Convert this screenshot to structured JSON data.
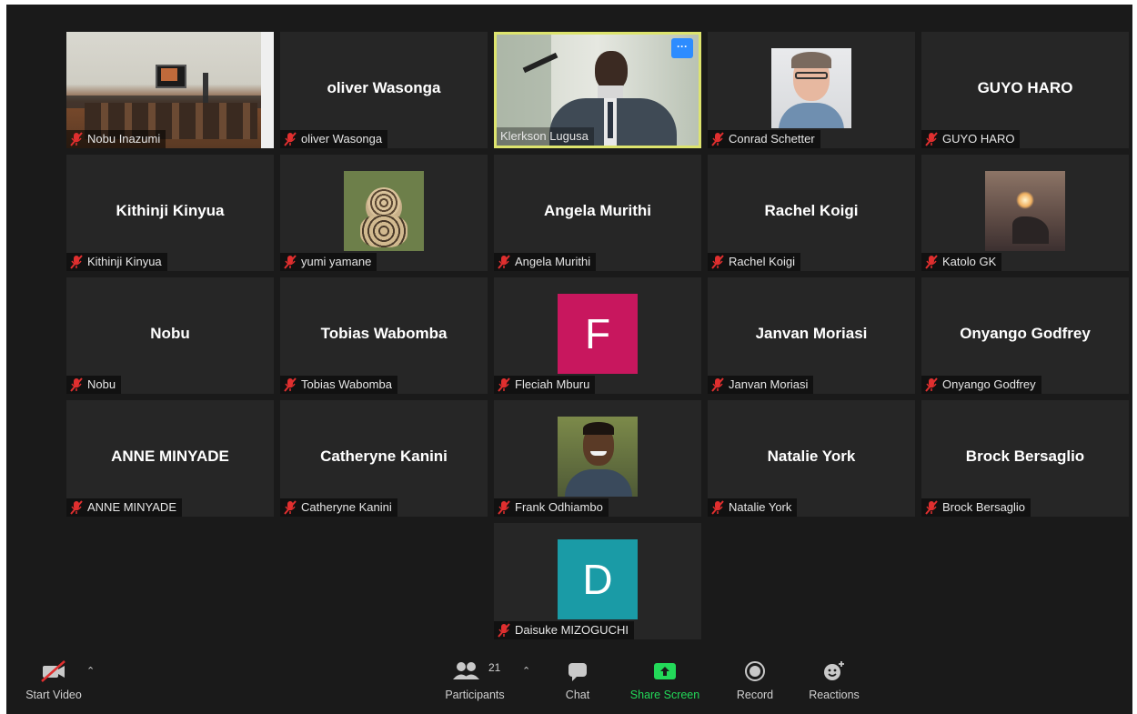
{
  "participants": [
    {
      "name": "Nobu Inazumi",
      "display": "video",
      "scene": "room"
    },
    {
      "name": "oliver Wasonga",
      "display": "name"
    },
    {
      "name": "Klerkson Lugusa",
      "display": "video",
      "scene": "speaker",
      "active": true
    },
    {
      "name": "Conrad Schetter",
      "display": "photo",
      "photo": "man-glasses"
    },
    {
      "name": "GUYO HARO",
      "display": "name"
    },
    {
      "name": "Kithinji Kinyua",
      "display": "name"
    },
    {
      "name": "yumi yamane",
      "display": "photo",
      "photo": "leopard-cub"
    },
    {
      "name": "Angela Murithi",
      "display": "name"
    },
    {
      "name": "Rachel Koigi",
      "display": "name"
    },
    {
      "name": "Katolo GK",
      "display": "photo",
      "photo": "sparkler"
    },
    {
      "name": "Nobu",
      "display": "name"
    },
    {
      "name": "Tobias Wabomba",
      "display": "name"
    },
    {
      "name": "Fleciah Mburu",
      "display": "initial",
      "initial": "F",
      "color": "#c8175e"
    },
    {
      "name": "Janvan Moriasi",
      "display": "name"
    },
    {
      "name": "Onyango Godfrey",
      "display": "name"
    },
    {
      "name": "ANNE MINYADE",
      "display": "name"
    },
    {
      "name": "Catheryne Kanini",
      "display": "name"
    },
    {
      "name": "Frank Odhiambo",
      "display": "photo",
      "photo": "man-smiling"
    },
    {
      "name": "Natalie York",
      "display": "name"
    },
    {
      "name": "Brock Bersaglio",
      "display": "name"
    },
    {
      "name": "Daisuke MIZOGUCHI",
      "display": "initial",
      "initial": "D",
      "color": "#1a9ba6"
    }
  ],
  "active_menu_label": "···",
  "toolbar": {
    "start_video": "Start Video",
    "participants": "Participants",
    "participants_count": "21",
    "chat": "Chat",
    "share_screen": "Share Screen",
    "record": "Record",
    "reactions": "Reactions"
  },
  "colors": {
    "background": "#1a1a1a",
    "tile": "#262626",
    "active_border": "#dde46e",
    "share": "#23d959",
    "muted": "#e02f2f",
    "menu_button": "#2d8cff"
  },
  "icons": {
    "video_off": "video-off-icon",
    "participants": "participants-icon",
    "chat": "chat-icon",
    "share": "share-screen-icon",
    "record": "record-icon",
    "reactions": "reactions-icon",
    "muted": "mic-muted-icon"
  }
}
